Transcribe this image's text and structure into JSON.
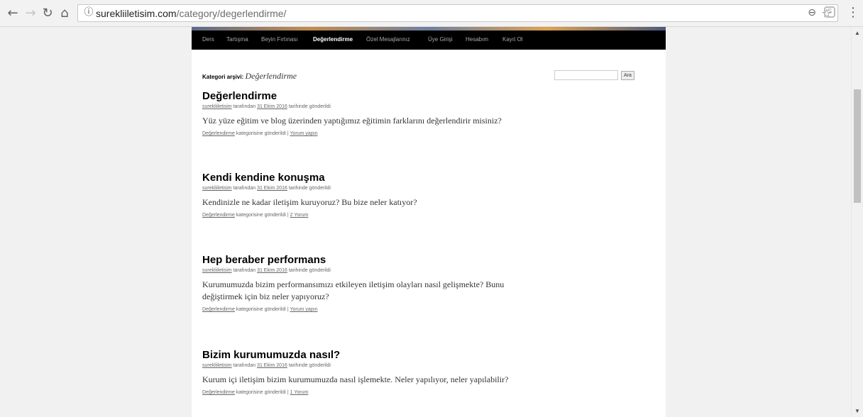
{
  "browser": {
    "url_host": "surekliiletisim.com",
    "url_path": "/category/degerlendirme/"
  },
  "nav": {
    "items": [
      {
        "label": "Ders",
        "active": false
      },
      {
        "label": "Tartışma",
        "active": false
      },
      {
        "label": "Beyin Fırtınası",
        "active": false
      },
      {
        "label": "Değerlendirme",
        "active": true
      },
      {
        "label": "Özel Mesajlarınız",
        "active": false
      },
      {
        "label": "Üye Girişi",
        "active": false
      },
      {
        "label": "Hesabım",
        "active": false
      },
      {
        "label": "Kayıt Ol",
        "active": false
      }
    ]
  },
  "archive": {
    "prefix": "Kategori arşivi:",
    "category": "Değerlendirme"
  },
  "search": {
    "value": "",
    "button": "Ara"
  },
  "posts": [
    {
      "title": "Değerlendirme",
      "author": "surekliiletisim",
      "by": "tarafından",
      "date": "31 Ekim 2016",
      "posted": "tarihinde gönderildi",
      "excerpt": "Yüz yüze eğitim ve blog üzerinden yaptığımız eğitimin farklarını değerlendirir misiniz?",
      "category": "Değerlendirme",
      "category_suffix": "kategorisine gönderildi |",
      "comments": "Yorum yapın"
    },
    {
      "title": "Kendi kendine konuşma",
      "author": "surekliiletisim",
      "by": "tarafından",
      "date": "31 Ekim 2016",
      "posted": "tarihinde gönderildi",
      "excerpt": "Kendinizle ne kadar iletişim kuruyoruz? Bu bize neler katıyor?",
      "category": "Değerlendirme",
      "category_suffix": "kategorisine gönderildi |",
      "comments": "2 Yorum"
    },
    {
      "title": "Hep beraber performans",
      "author": "surekliiletisim",
      "by": "tarafından",
      "date": "31 Ekim 2016",
      "posted": "tarihinde gönderildi",
      "excerpt": "Kurumumuzda bizim performansımızı etkileyen iletişim olayları nasıl gelişmekte? Bunu değiştirmek için biz neler yapıyoruz?",
      "category": "Değerlendirme",
      "category_suffix": "kategorisine gönderildi |",
      "comments": "Yorum yapın"
    },
    {
      "title": "Bizim kurumumuzda nasıl?",
      "author": "surekliiletisim",
      "by": "tarafından",
      "date": "31 Ekim 2016",
      "posted": "tarihinde gönderildi",
      "excerpt": "Kurum içi iletişim bizim kurumumuzda nasıl işlemekte. Neler yapılıyor, neler yapılabilir?",
      "category": "Değerlendirme",
      "category_suffix": "kategorisine gönderildi |",
      "comments": "1 Yorum"
    }
  ]
}
